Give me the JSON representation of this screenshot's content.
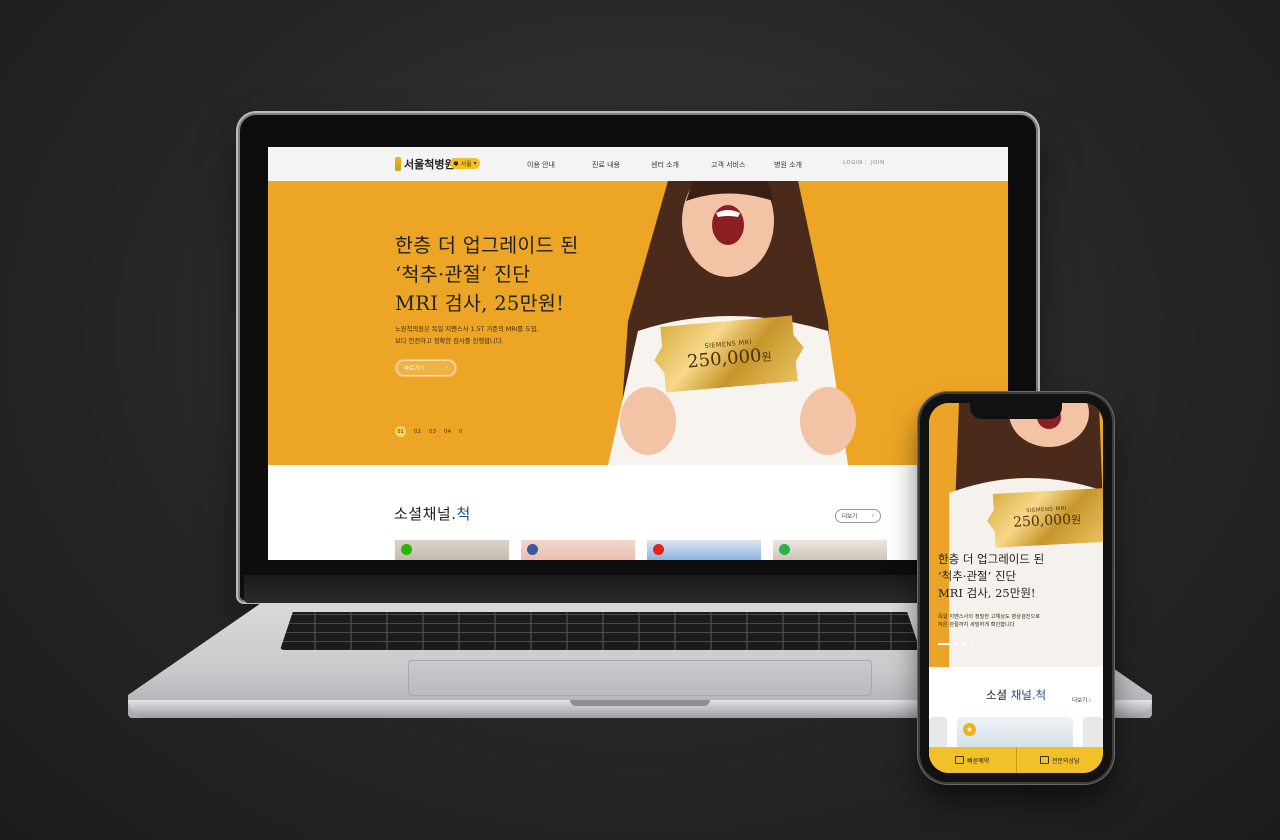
{
  "laptop_site": {
    "logo_text": "서울척병원",
    "location_pill": "서울",
    "nav": [
      "이용 안내",
      "진료 내용",
      "센터 소개",
      "고객 서비스",
      "병원 소개"
    ],
    "auth": {
      "login": "LOGIN",
      "join": "JOIN"
    },
    "hero": {
      "title": "한층 더 업그레이드 된\n‘척추·관절’ 진단\nMRI 검사, 25만원!",
      "description": "노원척의원은 독일 지멘스사 1.5T 기준의 MRI를 도입,\n보다 안전하고 정확한 검사를 진행합니다.",
      "button": "바로가기",
      "slides": [
        "01",
        "02",
        "03",
        "04"
      ],
      "pause": "II",
      "ticket_brand": "SIEMENS MRI",
      "ticket_price": "250,000",
      "ticket_unit": "원"
    },
    "social": {
      "title_prefix": "소셜채널.",
      "title_accent": "척",
      "more": "더보기"
    }
  },
  "mobile_site": {
    "ticket_brand": "SIEMENS MRI",
    "ticket_price": "250,000",
    "ticket_unit": "원",
    "title": "한층 더 업그레이드 된\n‘척추·관절’ 진단\nMRI 검사, 25만원!",
    "description": "독일 지멘스사의 정밀한 고해상도 영상검진으로\n작은 관절까지 세밀하게 확인합니다",
    "social_prefix": "소셜 ",
    "social_accent": "채널.척",
    "more": "더보기 ›",
    "bottom_bar": [
      "빠른예약",
      "전문의상담"
    ]
  },
  "colors": {
    "accent_yellow": "#eda525",
    "brand_blue": "#1e4c8c"
  }
}
